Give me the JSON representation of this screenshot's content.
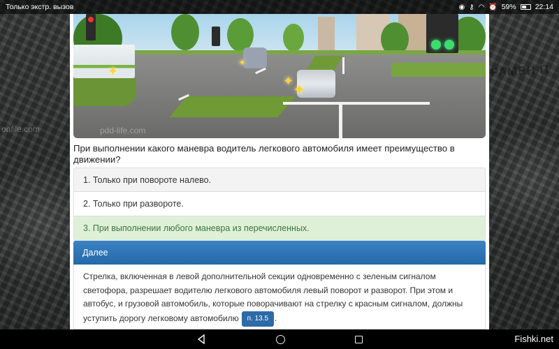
{
  "status_bar": {
    "left_text": "Только экстр. вызов",
    "battery": "59%",
    "battery_level": 0.59,
    "time": "22:14"
  },
  "scene": {
    "watermark": "pdd-life.com"
  },
  "question": {
    "text": "При выполнении какого маневра водитель легкового автомобиля имеет преимущество в движении?"
  },
  "answers": [
    {
      "label": "1. Только при повороте налево."
    },
    {
      "label": "2. Только при развороте."
    },
    {
      "label": "3. При выполнении любого маневра из перечисленных.",
      "correct": true
    }
  ],
  "next_button": {
    "label": "Далее"
  },
  "explanation": {
    "text": "Стрелка, включенная в левой дополнительной секции одновременно с зеленым сигналом светофора, разрешает водителю легкового автомобиля левый поворот и разворот. При этом и автобус, и грузовой автомобиль, которые поворачивают на стрелку с красным сигналом, должны уступить дорогу легковому автомобилю",
    "ref_badge": "п. 13.5",
    "suffix": "."
  },
  "background": {
    "side_text": "РАМЕН П",
    "watermark": "onfile.com"
  },
  "site_label": "Fishki.net",
  "colors": {
    "accent_blue": "#2469a8",
    "correct_bg": "#dff0d8",
    "correct_text": "#3c763d"
  }
}
